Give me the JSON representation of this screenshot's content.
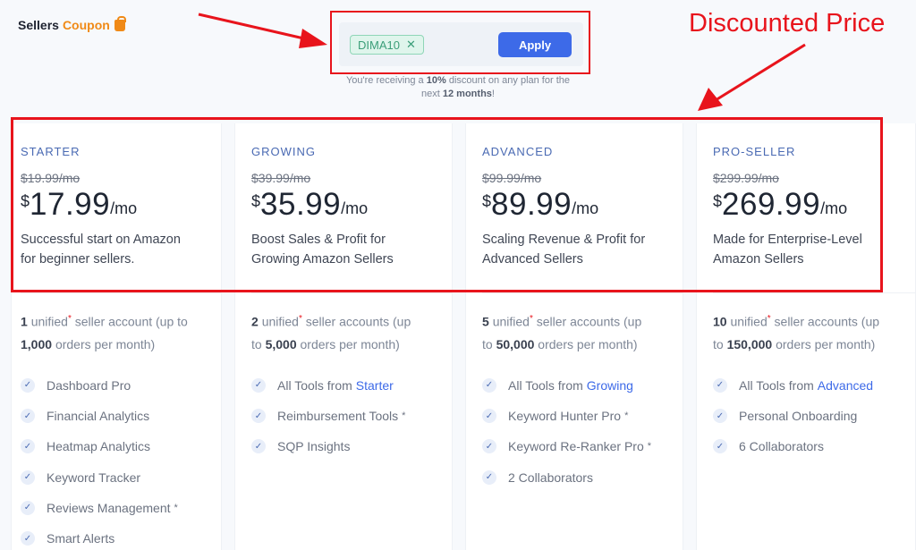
{
  "brand": {
    "name_part1": "Sellers",
    "name_part2": "Coupon"
  },
  "annotation": {
    "title": "Discounted Price"
  },
  "coupon": {
    "code": "DIMA10",
    "remove_glyph": "✕",
    "apply_label": "Apply",
    "message_prefix": "You're receiving a",
    "message_percent": "10%",
    "message_mid": "discount on any plan for the next",
    "message_duration": "12 months",
    "message_suffix": "!"
  },
  "colors": {
    "accent_red": "#e8141c",
    "brand_orange": "#f08a17",
    "primary_blue": "#3d6ae8",
    "plan_name_blue": "#4a6ab3"
  },
  "plans": [
    {
      "name": "STARTER",
      "old_price": "$19.99/mo",
      "currency": "$",
      "amount": "17.99",
      "period": "/mo",
      "tagline_line1": "Successful start on Amazon",
      "tagline_line2": "for beginner sellers.",
      "acc_count": "1",
      "acc_unified": "unified",
      "acc_star": "*",
      "acc_text1": "seller account (up to",
      "acc_orders": "1,000",
      "acc_text2": "orders per month)",
      "features": [
        {
          "text": "Dashboard Pro",
          "link": "",
          "star": ""
        },
        {
          "text": "Financial Analytics",
          "link": "",
          "star": ""
        },
        {
          "text": "Heatmap Analytics",
          "link": "",
          "star": ""
        },
        {
          "text": "Keyword Tracker",
          "link": "",
          "star": ""
        },
        {
          "text": "Reviews Management",
          "link": "",
          "star": "*"
        },
        {
          "text": "Smart Alerts",
          "link": "",
          "star": ""
        }
      ]
    },
    {
      "name": "GROWING",
      "old_price": "$39.99/mo",
      "currency": "$",
      "amount": "35.99",
      "period": "/mo",
      "tagline_line1": "Boost Sales & Profit for",
      "tagline_line2": "Growing Amazon Sellers",
      "acc_count": "2",
      "acc_unified": "unified",
      "acc_star": "*",
      "acc_text1": "seller accounts (up",
      "acc_pre": "to",
      "acc_orders": "5,000",
      "acc_text2": "orders per month)",
      "features": [
        {
          "text": "All Tools from",
          "link": "Starter",
          "star": ""
        },
        {
          "text": "Reimbursement Tools",
          "link": "",
          "star": "*"
        },
        {
          "text": "SQP Insights",
          "link": "",
          "star": ""
        }
      ]
    },
    {
      "name": "ADVANCED",
      "old_price": "$99.99/mo",
      "currency": "$",
      "amount": "89.99",
      "period": "/mo",
      "tagline_line1": "Scaling Revenue & Profit for",
      "tagline_line2": "Advanced Sellers",
      "acc_count": "5",
      "acc_unified": "unified",
      "acc_star": "*",
      "acc_text1": "seller accounts (up",
      "acc_pre": "to",
      "acc_orders": "50,000",
      "acc_text2": "orders per month)",
      "features": [
        {
          "text": "All Tools from",
          "link": "Growing",
          "star": ""
        },
        {
          "text": "Keyword Hunter Pro",
          "link": "",
          "star": "*"
        },
        {
          "text": "Keyword Re-Ranker Pro",
          "link": "",
          "star": "*"
        },
        {
          "text": "2 Collaborators",
          "link": "",
          "star": ""
        }
      ]
    },
    {
      "name": "PRO-SELLER",
      "old_price": "$299.99/mo",
      "currency": "$",
      "amount": "269.99",
      "period": "/mo",
      "tagline_line1": "Made for Enterprise-Level",
      "tagline_line2": "Amazon Sellers",
      "acc_count": "10",
      "acc_unified": "unified",
      "acc_star": "*",
      "acc_text1": "seller accounts (up",
      "acc_pre": "to",
      "acc_orders": "150,000",
      "acc_text2": "orders per month)",
      "features": [
        {
          "text": "All Tools from",
          "link": "Advanced",
          "star": ""
        },
        {
          "text": "Personal Onboarding",
          "link": "",
          "star": ""
        },
        {
          "text": "6 Collaborators",
          "link": "",
          "star": ""
        }
      ]
    }
  ]
}
